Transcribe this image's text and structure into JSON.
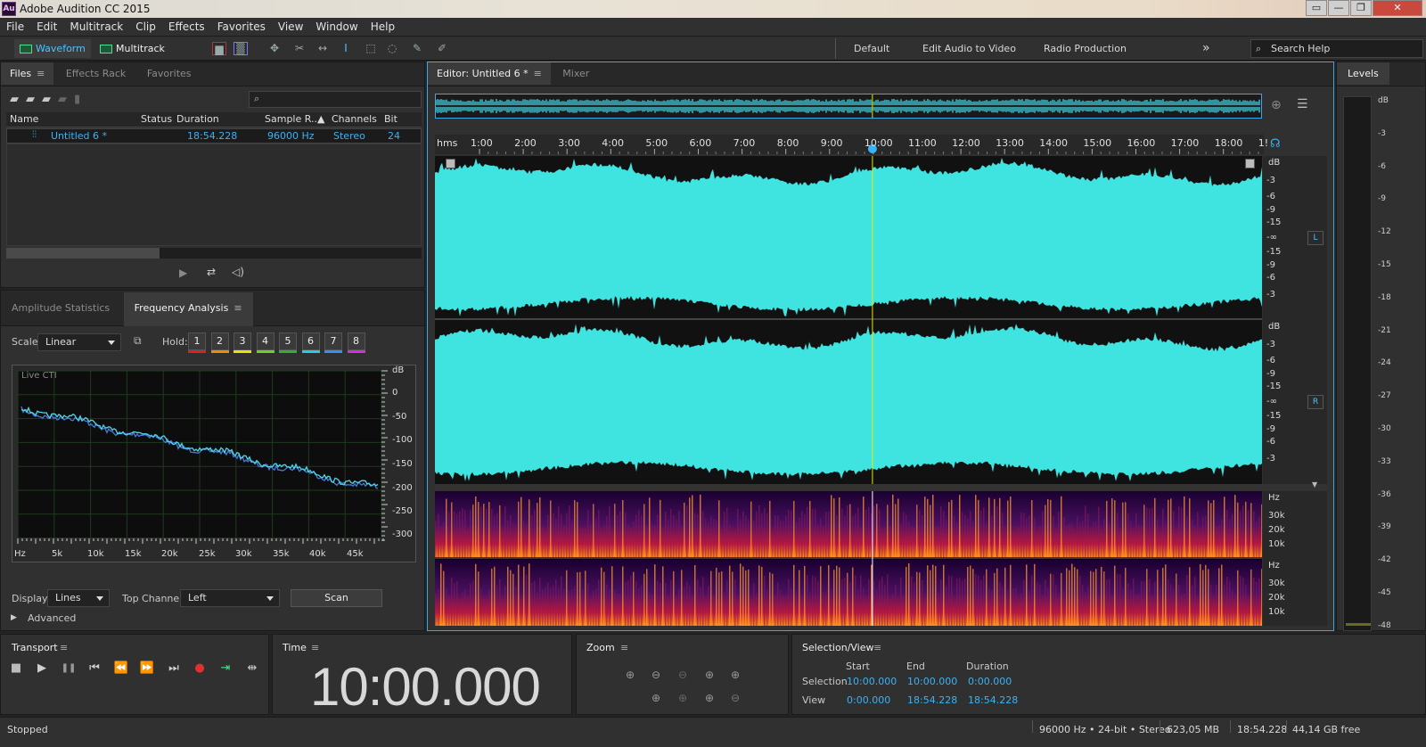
{
  "app": {
    "title": "Adobe Audition CC 2015",
    "logo": "Au",
    "window_buttons": [
      "▭",
      "—",
      "❐",
      "✕"
    ]
  },
  "menu": [
    "File",
    "Edit",
    "Multitrack",
    "Clip",
    "Effects",
    "Favorites",
    "View",
    "Window",
    "Help"
  ],
  "toolbar": {
    "waveform_label": "Waveform",
    "multitrack_label": "Multitrack",
    "workspaces": [
      "Default",
      "Edit Audio to Video",
      "Radio Production"
    ],
    "overflow_label": "»",
    "search_placeholder": "Search Help"
  },
  "files_panel": {
    "tabs": [
      "Files",
      "Effects Rack",
      "Favorites"
    ],
    "columns": [
      "Name",
      "Status",
      "Duration",
      "Sample R...",
      "Channels",
      "Bit Dept"
    ],
    "rows": [
      {
        "name": "Untitled 6 *",
        "status": "",
        "duration": "18:54.228",
        "sample_rate": "96000 Hz",
        "channels": "Stereo",
        "bit_depth": "24"
      }
    ]
  },
  "freq_panel": {
    "tabs": [
      "Amplitude Statistics",
      "Frequency Analysis"
    ],
    "scale_label": "Scale:",
    "scale_value": "Linear",
    "hold_label": "Hold:",
    "hold_buttons": [
      "1",
      "2",
      "3",
      "4",
      "5",
      "6",
      "7",
      "8"
    ],
    "hold_colors": [
      "#e02020",
      "#f08c00",
      "#f0e000",
      "#70d020",
      "#30b030",
      "#20d0e0",
      "#3090ff",
      "#d030e0"
    ],
    "graph_label": "Live CTI",
    "db_unit": "dB",
    "db_ticks": [
      "0",
      "-50",
      "-100",
      "-150",
      "-200",
      "-250",
      "-300"
    ],
    "hz_ticks": [
      "Hz",
      "5k",
      "10k",
      "15k",
      "20k",
      "25k",
      "30k",
      "35k",
      "40k",
      "45k"
    ],
    "display_label": "Display:",
    "display_value": "Lines",
    "top_channel_label": "Top Channel:",
    "top_channel_value": "Left",
    "scan_label": "Scan",
    "advanced_label": "Advanced"
  },
  "editor": {
    "tabs": [
      "Editor: Untitled 6 *",
      "Mixer"
    ],
    "ruler_unit": "hms",
    "ruler_ticks": [
      "1:00",
      "2:00",
      "3:00",
      "4:00",
      "5:00",
      "6:00",
      "7:00",
      "8:00",
      "9:00",
      "10:00",
      "11:00",
      "12:00",
      "13:00",
      "14:00",
      "15:00",
      "16:00",
      "17:00",
      "18:00",
      "1!"
    ],
    "db_unit": "dB",
    "db_scale": [
      "-3",
      "-6",
      "-9",
      "-15",
      "-∞",
      "-15",
      "-9",
      "-6",
      "-3"
    ],
    "channel_left": "L",
    "channel_right": "R",
    "hz_unit": "Hz",
    "hz_scale": [
      "30k",
      "20k",
      "10k"
    ],
    "waveform_color": "#3fe3e0",
    "playhead_color": "#e8e800",
    "playhead_fraction": 0.529
  },
  "levels": {
    "title": "Levels",
    "scale": [
      "dB",
      "-3",
      "-6",
      "-9",
      "-12",
      "-15",
      "-18",
      "-21",
      "-24",
      "-27",
      "-30",
      "-33",
      "-36",
      "-39",
      "-42",
      "-45",
      "-48"
    ]
  },
  "transport": {
    "title": "Transport",
    "buttons": [
      "■",
      "▶",
      "❚❚",
      "⏮",
      "⏪",
      "⏩",
      "⏭",
      "●",
      "⇥",
      "⇹"
    ]
  },
  "time": {
    "title": "Time",
    "value": "10:00.000"
  },
  "zoom": {
    "title": "Zoom"
  },
  "selection": {
    "title": "Selection/View",
    "headers": [
      "Start",
      "End",
      "Duration"
    ],
    "rows": [
      {
        "label": "Selection",
        "start": "10:00.000",
        "end": "10:00.000",
        "duration": "0:00.000"
      },
      {
        "label": "View",
        "start": "0:00.000",
        "end": "18:54.228",
        "duration": "18:54.228"
      }
    ]
  },
  "status": {
    "state": "Stopped",
    "format": "96000 Hz • 24-bit • Stereo",
    "size": "623,05 MB",
    "duration": "18:54.228",
    "free": "44,14 GB free"
  }
}
